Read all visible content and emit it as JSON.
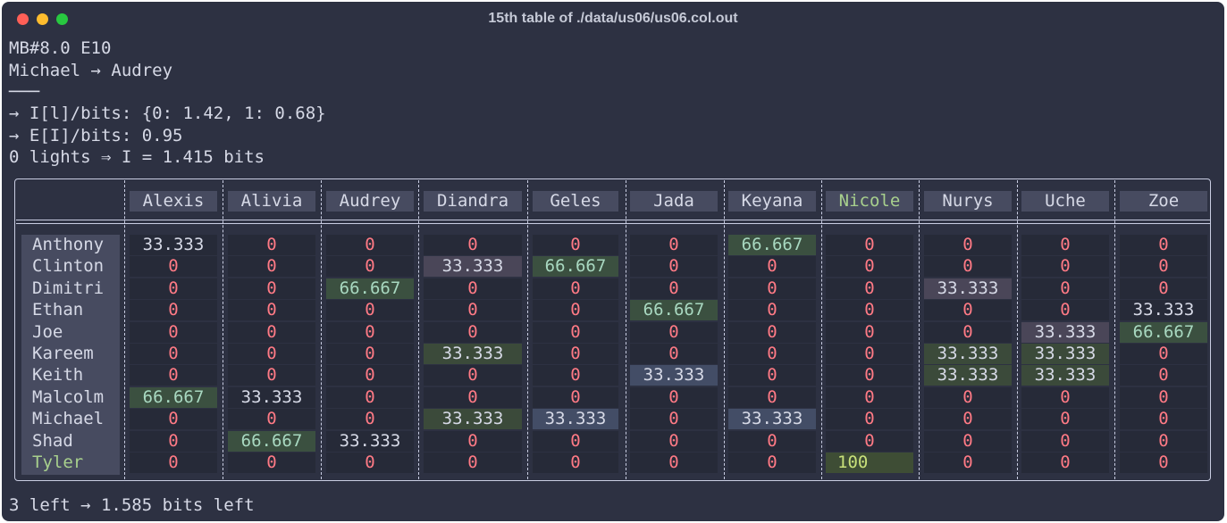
{
  "window": {
    "title": "15th table of ./data/us06/us06.col.out"
  },
  "terminal": {
    "lines": [
      "MB#8.0 E10",
      "Michael → Audrey",
      "───",
      "→ I[l]/bits: {0: 1.42, 1: 0.68}",
      "→ E[I]/bits: 0.95",
      "0 lights ⇒ I = 1.415 bits"
    ],
    "footer": "3 left → 1.585 bits left"
  },
  "table": {
    "columns": [
      "Alexis",
      "Alivia",
      "Audrey",
      "Diandra",
      "Geles",
      "Jada",
      "Keyana",
      "Nicole",
      "Nurys",
      "Uche",
      "Zoe"
    ],
    "highlight_column": "Nicole",
    "highlight_row": "Tyler",
    "rows": [
      {
        "name": "Anthony",
        "values": [
          "33.333",
          "0",
          "0",
          "0",
          "0",
          "0",
          "66.667",
          "0",
          "0",
          "0",
          "0"
        ]
      },
      {
        "name": "Clinton",
        "values": [
          "0",
          "0",
          "0",
          "33.333",
          "66.667",
          "0",
          "0",
          "0",
          "0",
          "0",
          "0"
        ]
      },
      {
        "name": "Dimitri",
        "values": [
          "0",
          "0",
          "66.667",
          "0",
          "0",
          "0",
          "0",
          "0",
          "33.333",
          "0",
          "0"
        ]
      },
      {
        "name": "Ethan",
        "values": [
          "0",
          "0",
          "0",
          "0",
          "0",
          "66.667",
          "0",
          "0",
          "0",
          "0",
          "33.333"
        ]
      },
      {
        "name": "Joe",
        "values": [
          "0",
          "0",
          "0",
          "0",
          "0",
          "0",
          "0",
          "0",
          "0",
          "33.333",
          "66.667"
        ]
      },
      {
        "name": "Kareem",
        "values": [
          "0",
          "0",
          "0",
          "33.333",
          "0",
          "0",
          "0",
          "0",
          "33.333",
          "33.333",
          "0"
        ]
      },
      {
        "name": "Keith",
        "values": [
          "0",
          "0",
          "0",
          "0",
          "0",
          "33.333",
          "0",
          "0",
          "33.333",
          "33.333",
          "0"
        ]
      },
      {
        "name": "Malcolm",
        "values": [
          "66.667",
          "33.333",
          "0",
          "0",
          "0",
          "0",
          "0",
          "0",
          "0",
          "0",
          "0"
        ]
      },
      {
        "name": "Michael",
        "values": [
          "0",
          "0",
          "0",
          "33.333",
          "33.333",
          "0",
          "33.333",
          "0",
          "0",
          "0",
          "0"
        ]
      },
      {
        "name": "Shad",
        "values": [
          "0",
          "66.667",
          "33.333",
          "0",
          "0",
          "0",
          "0",
          "0",
          "0",
          "0",
          "0"
        ]
      },
      {
        "name": "Tyler",
        "values": [
          "0",
          "0",
          "0",
          "0",
          "0",
          "0",
          "0",
          "100",
          "0",
          "0",
          "0"
        ]
      }
    ],
    "cell_styles": [
      [
        "plain",
        "zero",
        "zero",
        "zero",
        "zero",
        "zero",
        "green",
        "zero",
        "zero",
        "zero",
        "zero"
      ],
      [
        "zero",
        "zero",
        "zero",
        "purple",
        "green",
        "zero",
        "zero",
        "zero",
        "zero",
        "zero",
        "zero"
      ],
      [
        "zero",
        "zero",
        "green",
        "zero",
        "zero",
        "zero",
        "zero",
        "zero",
        "purple",
        "zero",
        "zero"
      ],
      [
        "zero",
        "zero",
        "zero",
        "zero",
        "zero",
        "green",
        "zero",
        "zero",
        "zero",
        "zero",
        "plain"
      ],
      [
        "zero",
        "zero",
        "zero",
        "zero",
        "zero",
        "zero",
        "zero",
        "zero",
        "zero",
        "purple",
        "green"
      ],
      [
        "zero",
        "zero",
        "zero",
        "olive",
        "zero",
        "zero",
        "zero",
        "zero",
        "olive",
        "olive",
        "zero"
      ],
      [
        "zero",
        "zero",
        "zero",
        "zero",
        "zero",
        "slate",
        "zero",
        "zero",
        "olive",
        "olive",
        "zero"
      ],
      [
        "green",
        "plain",
        "zero",
        "zero",
        "zero",
        "zero",
        "zero",
        "zero",
        "zero",
        "zero",
        "zero"
      ],
      [
        "zero",
        "zero",
        "zero",
        "olive",
        "slate",
        "zero",
        "slate",
        "zero",
        "zero",
        "zero",
        "zero"
      ],
      [
        "zero",
        "green",
        "plain",
        "zero",
        "zero",
        "zero",
        "zero",
        "zero",
        "zero",
        "zero",
        "zero"
      ],
      [
        "zero",
        "zero",
        "zero",
        "zero",
        "zero",
        "zero",
        "zero",
        "highlight",
        "zero",
        "zero",
        "zero"
      ]
    ],
    "colors": {
      "background": "#2d3142",
      "header_bg": "#474b60",
      "zero_text": "#ff7a85",
      "highlight_text": "#a8d08d",
      "green_cell": "#3b5040",
      "purple_cell": "#4a4658",
      "slate_cell": "#434d66",
      "olive_cell": "#3b4a3a"
    }
  }
}
